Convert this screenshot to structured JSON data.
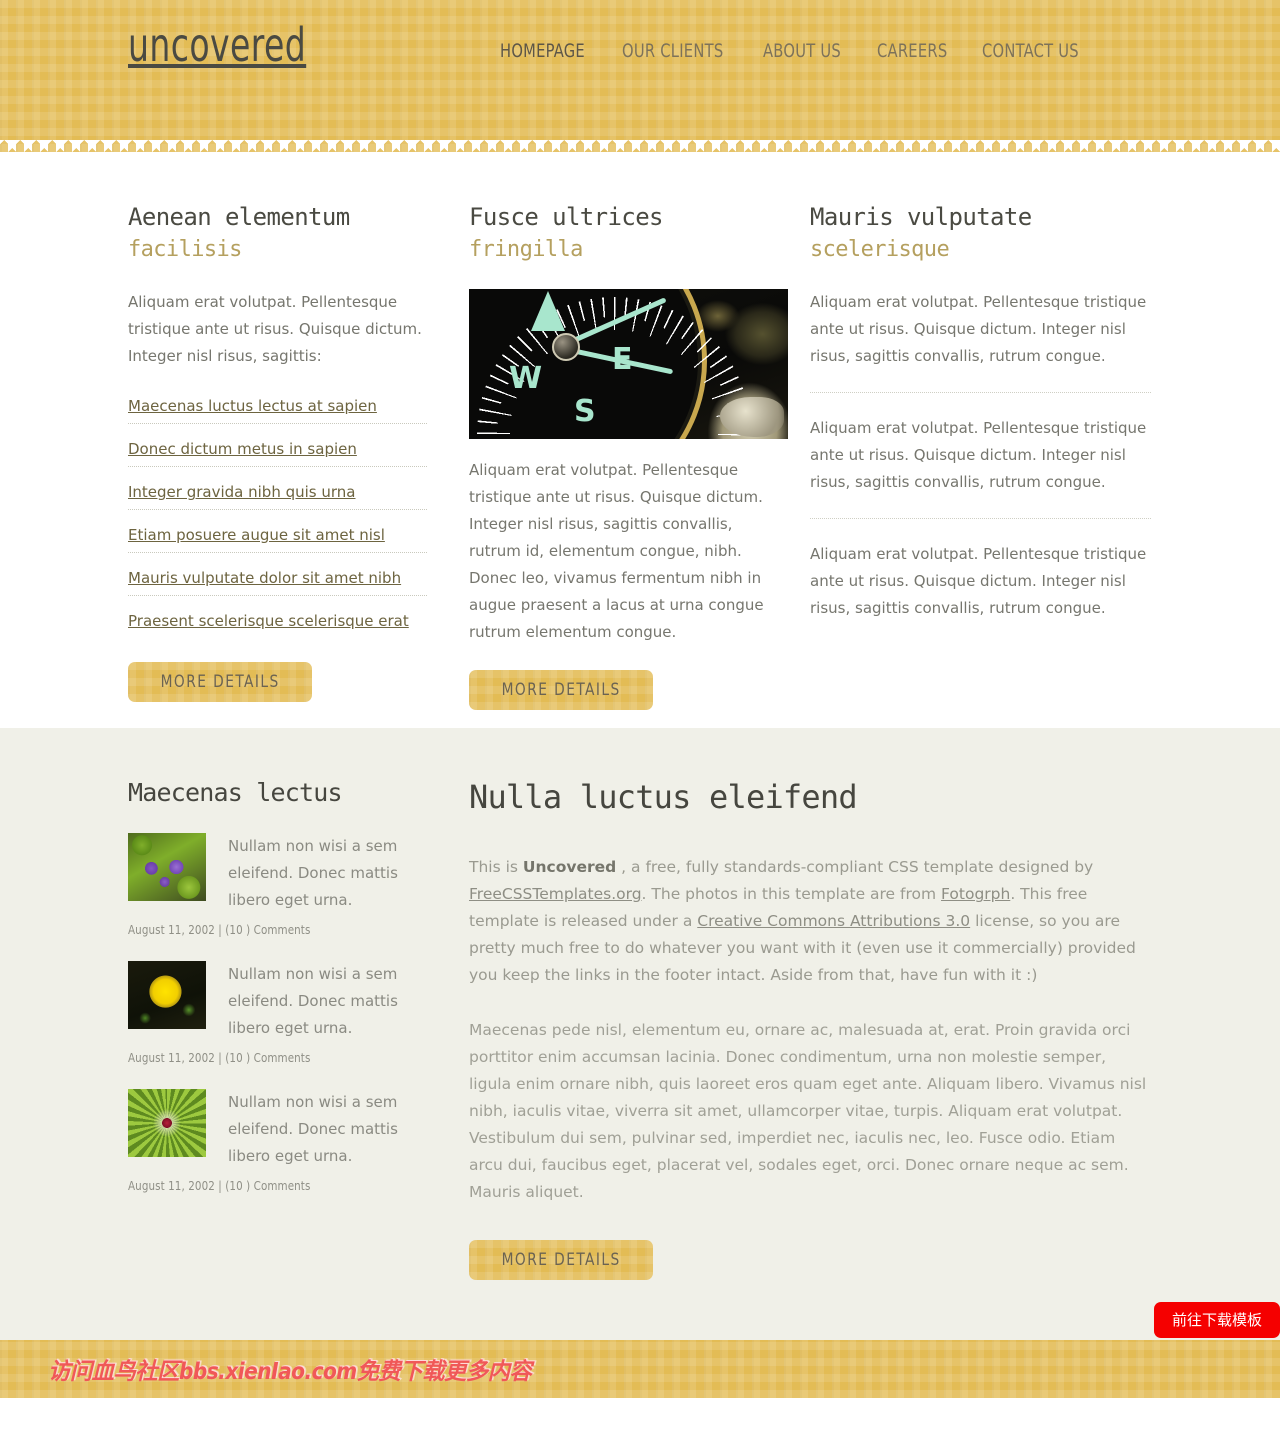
{
  "site": {
    "logo": "uncovered",
    "accent_gold": "#e3bc55",
    "accent_dark": "#4a4a42",
    "sub_gold": "#b5a05f",
    "cta_red": "#f50000"
  },
  "nav": {
    "items": [
      {
        "label": "HOMEPAGE",
        "current": true
      },
      {
        "label": "OUR CLIENTS",
        "current": false
      },
      {
        "label": "ABOUT US",
        "current": false
      },
      {
        "label": "CAREERS",
        "current": false
      },
      {
        "label": "CONTACT US",
        "current": false
      }
    ]
  },
  "splash": {
    "col1": {
      "title": "Aenean elementum",
      "subtitle": "facilisis",
      "intro": "Aliquam erat volutpat. Pellentesque tristique ante ut risus. Quisque dictum. Integer nisl risus, sagittis:",
      "links": [
        "Maecenas luctus lectus at sapien",
        "Donec dictum metus in sapien",
        "Integer gravida nibh quis urna",
        "Etiam posuere augue sit amet nisl",
        "Mauris vulputate dolor sit amet nibh",
        "Praesent scelerisque scelerisque erat"
      ],
      "button": "MORE DETAILS"
    },
    "col2": {
      "title": "Fusce ultrices",
      "subtitle": "fringilla",
      "image_alt": "compass-photo",
      "body": "Aliquam erat volutpat. Pellentesque tristique ante ut risus. Quisque dictum. Integer nisl risus, sagittis convallis, rutrum id, elementum congue, nibh. Donec leo, vivamus fermentum nibh in augue praesent a lacus at urna congue rutrum elementum congue.",
      "button": "MORE DETAILS"
    },
    "col3": {
      "title": "Mauris vulputate",
      "subtitle": "scelerisque",
      "blocks": [
        "Aliquam erat volutpat. Pellentesque tristique ante ut risus. Quisque dictum. Integer nisl risus, sagittis convallis, rutrum congue.",
        "Aliquam erat volutpat. Pellentesque tristique ante ut risus. Quisque dictum. Integer nisl risus, sagittis convallis, rutrum congue.",
        "Aliquam erat volutpat. Pellentesque tristique ante ut risus. Quisque dictum. Integer nisl risus, sagittis convallis, rutrum congue."
      ]
    }
  },
  "sidebar": {
    "title": "Maecenas lectus",
    "posts": [
      {
        "thumb": "violet-flower-thumb",
        "text": "Nullam non wisi a sem eleifend. Donec mattis libero eget urna.",
        "meta": "August 11, 2002 | (10 ) Comments"
      },
      {
        "thumb": "marigold-flower-thumb",
        "text": "Nullam non wisi a sem eleifend. Donec mattis libero eget urna.",
        "meta": "August 11, 2002 | (10 ) Comments"
      },
      {
        "thumb": "spiky-flower-thumb",
        "text": "Nullam non wisi a sem eleifend. Donec mattis libero eget urna.",
        "meta": "August 11, 2002 | (10 ) Comments"
      }
    ]
  },
  "content": {
    "title": "Nulla luctus eleifend",
    "lead": {
      "p1": "This is ",
      "strong": "Uncovered",
      "p2": " , a free, fully standards-compliant CSS template designed by ",
      "link1": "FreeCSSTemplates.org",
      "p3": ". The photos in this template are from ",
      "link2": "Fotogrph",
      "p4": ". This free template is released under a ",
      "link3": "Creative Commons Attributions 3.0",
      "p5": " license, so you are pretty much free to do whatever you want with it (even use it commercially) provided you keep the links in the footer intact. Aside from that, have fun with it :)"
    },
    "paragraph": "Maecenas pede nisl, elementum eu, ornare ac, malesuada at, erat. Proin gravida orci porttitor enim accumsan lacinia. Donec condimentum, urna non molestie semper, ligula enim ornare nibh, quis laoreet eros quam eget ante. Aliquam libero. Vivamus nisl nibh, iaculis vitae, viverra sit amet, ullamcorper vitae, turpis. Aliquam erat volutpat. Vestibulum dui sem, pulvinar sed, imperdiet nec, iaculis nec, leo. Fusce odio. Etiam arcu dui, faucibus eget, placerat vel, sodales eget, orci. Donec ornare neque ac sem. Mauris aliquet.",
    "button": "MORE DETAILS"
  },
  "footer": {
    "watermark": "访问血鸟社区bbs.xienIao.com免费下载更多内容"
  },
  "cta": {
    "label": "前往下载模板"
  }
}
